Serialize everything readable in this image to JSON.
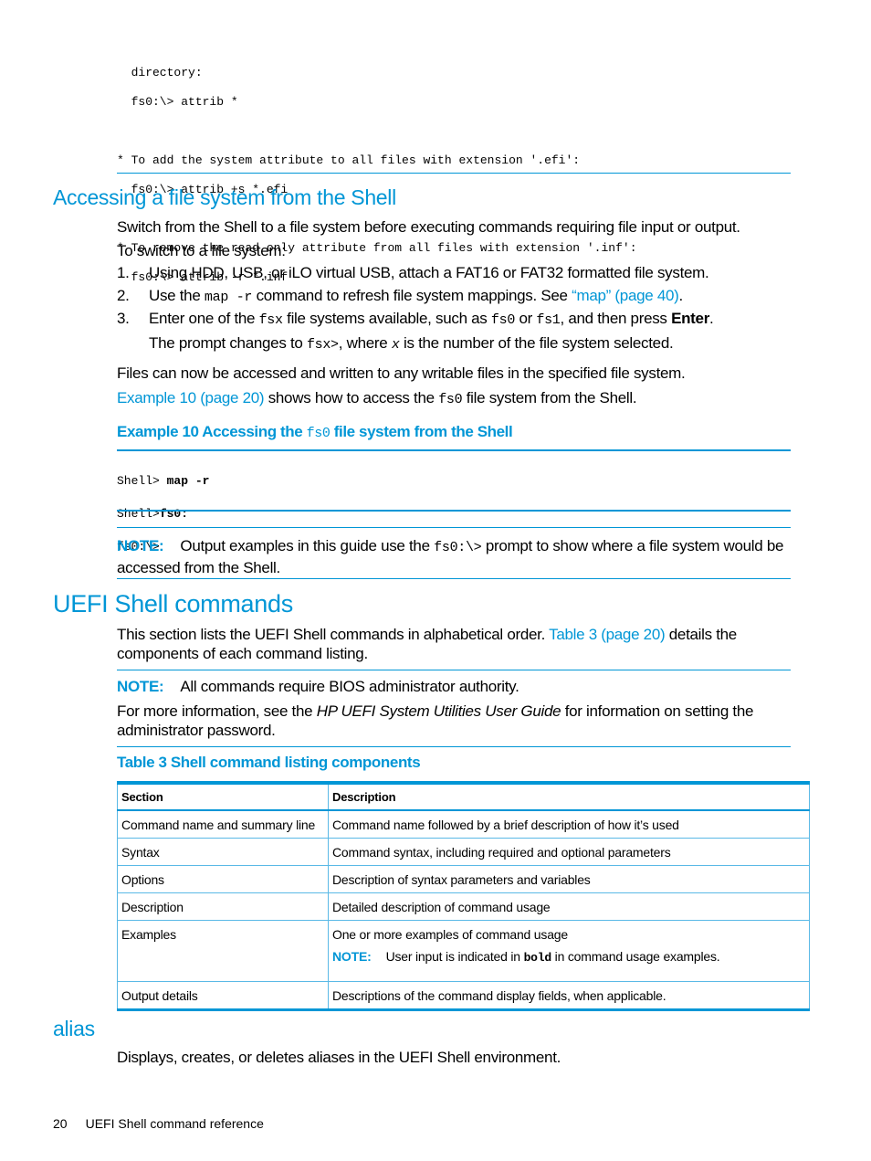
{
  "top_code": {
    "lines": [
      "  directory:",
      "  fs0:\\> attrib *",
      "",
      "* To add the system attribute to all files with extension '.efi':",
      "  fs0:\\> attrib +s *.efi",
      "",
      "* To remove the read only attribute from all files with extension '.inf':",
      "  fs0:\\> attrib -r *.inf"
    ]
  },
  "section_access": {
    "heading": "Accessing a file system from the Shell",
    "intro": "Switch from the Shell to a file system before executing commands requiring file input or output.",
    "steps_intro": "To switch to a file system:",
    "steps": [
      {
        "num": "1.",
        "text": "Using HDD, USB, or iLO virtual USB, attach a FAT16 or FAT32 formatted file system."
      },
      {
        "num": "2.",
        "pre": "Use the ",
        "code": "map -r",
        "mid": " command to refresh file system mappings. See ",
        "link": "“map” (page 40)",
        "post": "."
      },
      {
        "num": "3.",
        "pre": "Enter one of the ",
        "code1": "fsx",
        "mid1": " file systems available, such as ",
        "code2": "fs0",
        "mid2": " or ",
        "code3": "fs1",
        "mid3": ", and then press ",
        "bold": "Enter",
        "post": "."
      }
    ],
    "step3_sub": {
      "pre": "The prompt changes to ",
      "code1": "fsx>",
      "mid": ", where ",
      "code2": "x",
      "post": " is the number of the file system selected."
    },
    "after1": "Files can now be accessed and written to any writable files in the specified file system.",
    "after2": {
      "link": "Example 10 (page 20)",
      "pre": " shows how to access the ",
      "code": "fs0",
      "post": " file system from the Shell."
    }
  },
  "example": {
    "caption_pre": "Example 10 Accessing the ",
    "caption_code": "fs0",
    "caption_post": " file system from the Shell",
    "lines": [
      {
        "prompt": "Shell> ",
        "input": "map -r"
      },
      {
        "prompt": "Shell>",
        "input": "fs0:"
      },
      {
        "prompt": "fs0:\\>",
        "input": ""
      }
    ]
  },
  "note1": {
    "label": "NOTE:",
    "pre": "Output examples in this guide use the ",
    "code": "fs0:\\>",
    "post": " prompt to show where a file system would be accessed from the Shell."
  },
  "section_uefi": {
    "heading": "UEFI Shell commands",
    "intro_pre": "This section lists the UEFI Shell commands in alphabetical order. ",
    "intro_link": "Table 3 (page 20)",
    "intro_post": " details the components of each command listing.",
    "note_label": "NOTE:",
    "note_text": "All commands require BIOS administrator authority.",
    "more_pre": "For more information, see the ",
    "more_italic": "HP UEFI System Utilities User Guide",
    "more_post": " for information on setting the administrator password."
  },
  "table": {
    "caption": "Table 3 Shell command listing components",
    "headers": [
      "Section",
      "Description"
    ],
    "rows": [
      {
        "section": "Command name and summary line",
        "description": "Command name followed by a brief description of how it’s used"
      },
      {
        "section": "Syntax",
        "description": "Command syntax, including required and optional parameters"
      },
      {
        "section": "Options",
        "description": "Description of syntax parameters and variables"
      },
      {
        "section": "Description",
        "description": "Detailed description of command usage"
      },
      {
        "section": "Examples",
        "description": "One or more examples of command usage"
      },
      {
        "section": "Output details",
        "description": "Descriptions of the command display fields, when applicable."
      }
    ],
    "examples_note": {
      "label": "NOTE:",
      "pre": "User input is indicated in ",
      "code": "bold",
      "post": " in command usage examples."
    }
  },
  "section_alias": {
    "heading": "alias",
    "text": "Displays, creates, or deletes aliases in the UEFI Shell environment."
  },
  "footer": {
    "page": "20",
    "title": "UEFI Shell command reference"
  },
  "colors": {
    "accent": "#0096d6",
    "table_border": "#5ab9e6"
  }
}
